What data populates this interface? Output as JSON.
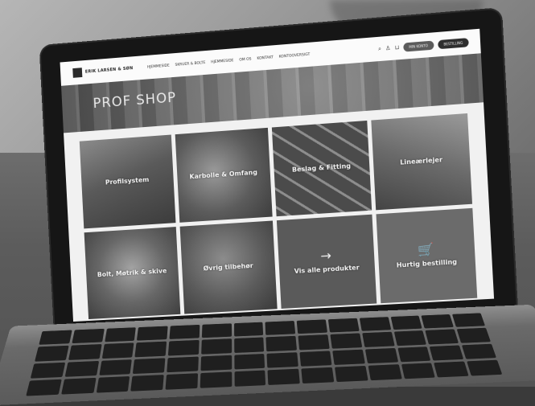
{
  "site": {
    "brand": "ERIK LARSEN & SØN",
    "nav": [
      "HJEMMESIDE",
      "SKRUER & BOLTE",
      "HJEMMESIDE",
      "OM OS",
      "KONTAKT",
      "KONTOOVERSIGT"
    ],
    "buttons": {
      "login": "MIN KONTO",
      "cart": "BESTILLING"
    },
    "hero_title": "PROF SHOP",
    "tiles": [
      {
        "label": "Profilsystem",
        "style": "t1"
      },
      {
        "label": "Karbolle & Omfang",
        "style": "t2"
      },
      {
        "label": "Beslag & Fitting",
        "style": "t3"
      },
      {
        "label": "Lineærlejer",
        "style": "t4"
      },
      {
        "label": "Bolt, Møtrik & skive",
        "style": "t5"
      },
      {
        "label": "Øvrig tilbehør",
        "style": "t6"
      },
      {
        "label": "Vis alle produkter",
        "icon": "arrow-right-icon",
        "glyph": "→",
        "style": "plain"
      },
      {
        "label": "Hurtig bestilling",
        "icon": "cart-icon",
        "glyph": "🛒",
        "style": "plain2"
      }
    ]
  }
}
